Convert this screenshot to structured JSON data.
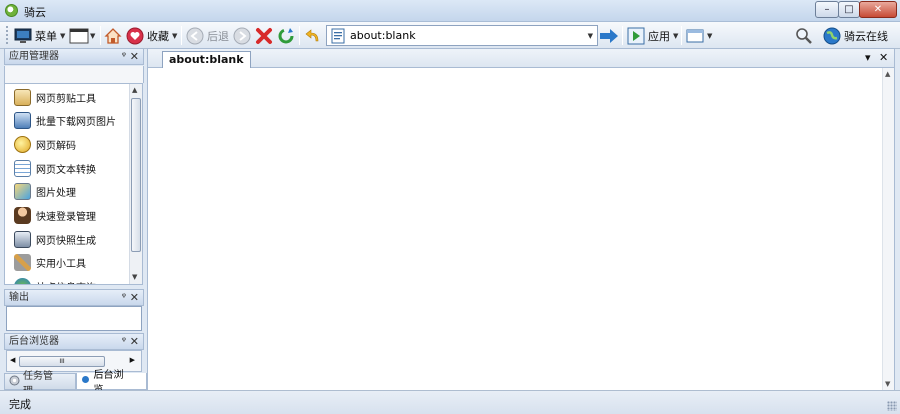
{
  "window": {
    "title": "骑云",
    "minimize_glyph": "–",
    "maximize_glyph": "□",
    "close_glyph": "✕"
  },
  "toolbar": {
    "menu_label": "菜单",
    "favorites_label": "收藏",
    "back_label": "后退",
    "apps_label": "应用",
    "online_label": "骑云在线",
    "address_value": "about:blank"
  },
  "sidebar": {
    "app_manager_title": "应用管理器",
    "tools": [
      {
        "label": "网页剪贴工具",
        "icon": "clipboard-icon"
      },
      {
        "label": "批量下载网页图片",
        "icon": "download-images-icon"
      },
      {
        "label": "网页解码",
        "icon": "decode-icon"
      },
      {
        "label": "网页文本转换",
        "icon": "text-convert-icon"
      },
      {
        "label": "图片处理",
        "icon": "image-process-icon"
      },
      {
        "label": "快速登录管理",
        "icon": "user-login-icon"
      },
      {
        "label": "网页快照生成",
        "icon": "snapshot-icon"
      },
      {
        "label": "实用小工具",
        "icon": "tools-icon"
      },
      {
        "label": "站点信息查询",
        "icon": "site-info-icon"
      }
    ],
    "output_title": "输出",
    "background_browser_title": "后台浏览器",
    "scroll_grip": "III",
    "bottom_tabs": [
      {
        "label": "任务管理...",
        "icon": "task-gear-icon"
      },
      {
        "label": "后台浏览...",
        "icon": "globe-dot-icon"
      }
    ],
    "pin_glyph": "ᵠ",
    "close_glyph": "✕"
  },
  "document": {
    "tab_label": "about:blank",
    "dropdown_glyph": "▾",
    "close_glyph": "✕"
  },
  "status": {
    "text": "完成"
  },
  "colors": {
    "accent_blue": "#2a78c9",
    "stop_red": "#d82a2a",
    "refresh_green": "#2f9b3a",
    "panel_border": "#a9bbd3"
  }
}
